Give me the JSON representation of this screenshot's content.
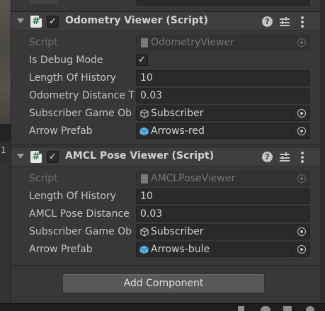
{
  "scene_side_text": "1",
  "components": [
    {
      "title": "Odometry Viewer (Script)",
      "enabled_glyph": "✓",
      "rows": [
        {
          "kind": "object",
          "label": "Script",
          "value": "OdometryViewer",
          "icon": "script-file-icon",
          "dim": true
        },
        {
          "kind": "checkbox",
          "label": "Is Debug Mode",
          "checked_glyph": "✓"
        },
        {
          "kind": "text",
          "label": "Length Of History",
          "value": "10"
        },
        {
          "kind": "text",
          "label": "Odometry Distance T",
          "value": "0.03"
        },
        {
          "kind": "object",
          "label": "Subscriber Game Ob",
          "value": "Subscriber",
          "icon": "gameobject-icon"
        },
        {
          "kind": "object",
          "label": "Arrow Prefab",
          "value": "Arrows-red",
          "icon": "prefab-icon"
        }
      ]
    },
    {
      "title": "AMCL Pose Viewer (Script)",
      "enabled_glyph": "✓",
      "rows": [
        {
          "kind": "object",
          "label": "Script",
          "value": "AMCLPoseViewer",
          "icon": "script-file-icon",
          "dim": true
        },
        {
          "kind": "text",
          "label": "Length Of History",
          "value": "10"
        },
        {
          "kind": "text",
          "label": "AMCL Pose Distance",
          "value": "0.03"
        },
        {
          "kind": "object",
          "label": "Subscriber Game Ob",
          "value": "Subscriber",
          "icon": "gameobject-icon"
        },
        {
          "kind": "object",
          "label": "Arrow Prefab",
          "value": "Arrows-bule",
          "icon": "prefab-icon"
        }
      ]
    }
  ],
  "add_component_label": "Add Component",
  "icons": {
    "script": "#",
    "help": "?",
    "prefab_color": "#5fb3e6",
    "script_green": "#2b7c3c"
  }
}
